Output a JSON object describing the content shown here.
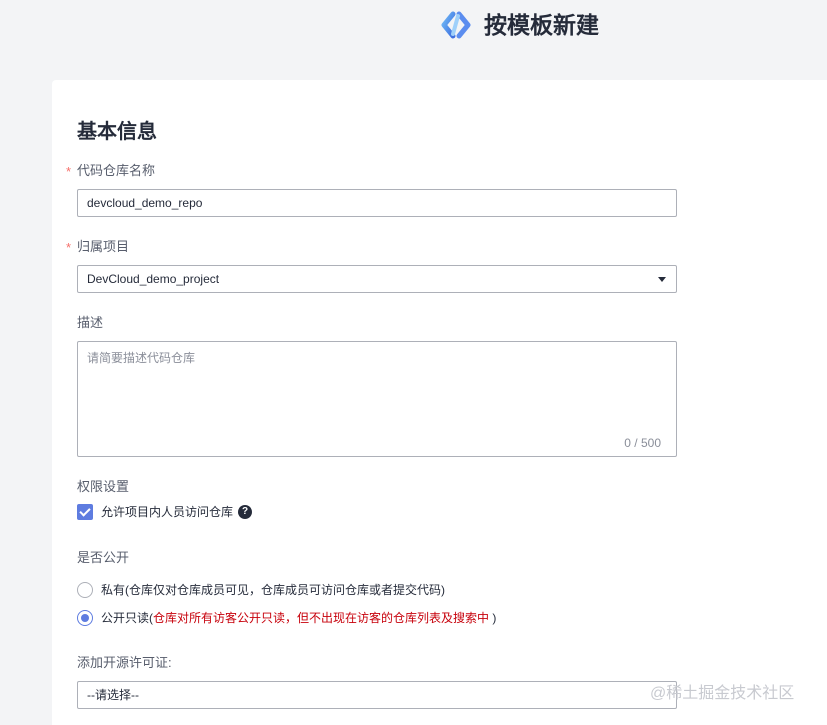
{
  "header": {
    "title": "按模板新建",
    "logo_icon": "devcloud-logo-icon"
  },
  "form": {
    "section_title": "基本信息",
    "required_mark": "*",
    "repo_name": {
      "label": "代码仓库名称",
      "value": "devcloud_demo_repo"
    },
    "project": {
      "label": "归属项目",
      "value": "DevCloud_demo_project"
    },
    "description": {
      "label": "描述",
      "placeholder": "请简要描述代码仓库",
      "counter": "0 / 500"
    },
    "permission": {
      "label": "权限设置",
      "checkbox_label": "允许项目内人员访问仓库",
      "checked": true,
      "help_icon_text": "?"
    },
    "visibility": {
      "label": "是否公开",
      "options": [
        {
          "prefix": "私有(仓库仅对仓库成员可见，仓库成员可访问仓库或者提交代码)",
          "note": "",
          "suffix": "",
          "selected": false
        },
        {
          "prefix": "公开只读(",
          "note": "仓库对所有访客公开只读，但不出现在访客的仓库列表及搜索中",
          "suffix": " )",
          "selected": true
        }
      ]
    },
    "license": {
      "label": "添加开源许可证:",
      "value": "--请选择--"
    }
  },
  "watermark": "@稀土掘金技术社区",
  "colors": {
    "accent": "#5e7ce0",
    "required": "#f66f6a",
    "warning": "#c7000b"
  }
}
